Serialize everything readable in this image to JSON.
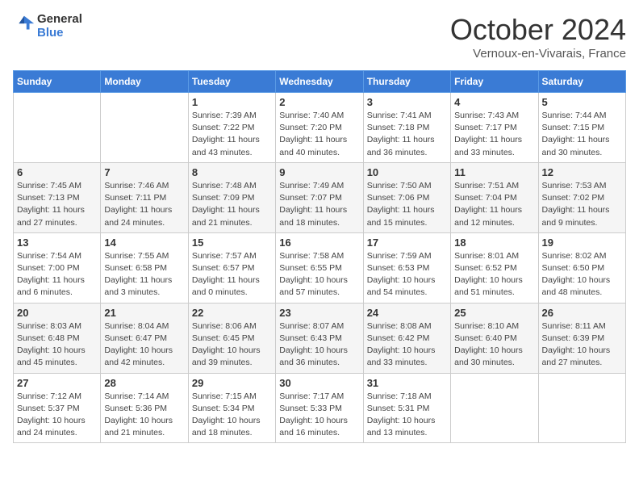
{
  "header": {
    "logo_line1": "General",
    "logo_line2": "Blue",
    "month": "October 2024",
    "location": "Vernoux-en-Vivarais, France"
  },
  "days_of_week": [
    "Sunday",
    "Monday",
    "Tuesday",
    "Wednesday",
    "Thursday",
    "Friday",
    "Saturday"
  ],
  "weeks": [
    [
      {
        "day": "",
        "sunrise": "",
        "sunset": "",
        "daylight": ""
      },
      {
        "day": "",
        "sunrise": "",
        "sunset": "",
        "daylight": ""
      },
      {
        "day": "1",
        "sunrise": "Sunrise: 7:39 AM",
        "sunset": "Sunset: 7:22 PM",
        "daylight": "Daylight: 11 hours and 43 minutes."
      },
      {
        "day": "2",
        "sunrise": "Sunrise: 7:40 AM",
        "sunset": "Sunset: 7:20 PM",
        "daylight": "Daylight: 11 hours and 40 minutes."
      },
      {
        "day": "3",
        "sunrise": "Sunrise: 7:41 AM",
        "sunset": "Sunset: 7:18 PM",
        "daylight": "Daylight: 11 hours and 36 minutes."
      },
      {
        "day": "4",
        "sunrise": "Sunrise: 7:43 AM",
        "sunset": "Sunset: 7:17 PM",
        "daylight": "Daylight: 11 hours and 33 minutes."
      },
      {
        "day": "5",
        "sunrise": "Sunrise: 7:44 AM",
        "sunset": "Sunset: 7:15 PM",
        "daylight": "Daylight: 11 hours and 30 minutes."
      }
    ],
    [
      {
        "day": "6",
        "sunrise": "Sunrise: 7:45 AM",
        "sunset": "Sunset: 7:13 PM",
        "daylight": "Daylight: 11 hours and 27 minutes."
      },
      {
        "day": "7",
        "sunrise": "Sunrise: 7:46 AM",
        "sunset": "Sunset: 7:11 PM",
        "daylight": "Daylight: 11 hours and 24 minutes."
      },
      {
        "day": "8",
        "sunrise": "Sunrise: 7:48 AM",
        "sunset": "Sunset: 7:09 PM",
        "daylight": "Daylight: 11 hours and 21 minutes."
      },
      {
        "day": "9",
        "sunrise": "Sunrise: 7:49 AM",
        "sunset": "Sunset: 7:07 PM",
        "daylight": "Daylight: 11 hours and 18 minutes."
      },
      {
        "day": "10",
        "sunrise": "Sunrise: 7:50 AM",
        "sunset": "Sunset: 7:06 PM",
        "daylight": "Daylight: 11 hours and 15 minutes."
      },
      {
        "day": "11",
        "sunrise": "Sunrise: 7:51 AM",
        "sunset": "Sunset: 7:04 PM",
        "daylight": "Daylight: 11 hours and 12 minutes."
      },
      {
        "day": "12",
        "sunrise": "Sunrise: 7:53 AM",
        "sunset": "Sunset: 7:02 PM",
        "daylight": "Daylight: 11 hours and 9 minutes."
      }
    ],
    [
      {
        "day": "13",
        "sunrise": "Sunrise: 7:54 AM",
        "sunset": "Sunset: 7:00 PM",
        "daylight": "Daylight: 11 hours and 6 minutes."
      },
      {
        "day": "14",
        "sunrise": "Sunrise: 7:55 AM",
        "sunset": "Sunset: 6:58 PM",
        "daylight": "Daylight: 11 hours and 3 minutes."
      },
      {
        "day": "15",
        "sunrise": "Sunrise: 7:57 AM",
        "sunset": "Sunset: 6:57 PM",
        "daylight": "Daylight: 11 hours and 0 minutes."
      },
      {
        "day": "16",
        "sunrise": "Sunrise: 7:58 AM",
        "sunset": "Sunset: 6:55 PM",
        "daylight": "Daylight: 10 hours and 57 minutes."
      },
      {
        "day": "17",
        "sunrise": "Sunrise: 7:59 AM",
        "sunset": "Sunset: 6:53 PM",
        "daylight": "Daylight: 10 hours and 54 minutes."
      },
      {
        "day": "18",
        "sunrise": "Sunrise: 8:01 AM",
        "sunset": "Sunset: 6:52 PM",
        "daylight": "Daylight: 10 hours and 51 minutes."
      },
      {
        "day": "19",
        "sunrise": "Sunrise: 8:02 AM",
        "sunset": "Sunset: 6:50 PM",
        "daylight": "Daylight: 10 hours and 48 minutes."
      }
    ],
    [
      {
        "day": "20",
        "sunrise": "Sunrise: 8:03 AM",
        "sunset": "Sunset: 6:48 PM",
        "daylight": "Daylight: 10 hours and 45 minutes."
      },
      {
        "day": "21",
        "sunrise": "Sunrise: 8:04 AM",
        "sunset": "Sunset: 6:47 PM",
        "daylight": "Daylight: 10 hours and 42 minutes."
      },
      {
        "day": "22",
        "sunrise": "Sunrise: 8:06 AM",
        "sunset": "Sunset: 6:45 PM",
        "daylight": "Daylight: 10 hours and 39 minutes."
      },
      {
        "day": "23",
        "sunrise": "Sunrise: 8:07 AM",
        "sunset": "Sunset: 6:43 PM",
        "daylight": "Daylight: 10 hours and 36 minutes."
      },
      {
        "day": "24",
        "sunrise": "Sunrise: 8:08 AM",
        "sunset": "Sunset: 6:42 PM",
        "daylight": "Daylight: 10 hours and 33 minutes."
      },
      {
        "day": "25",
        "sunrise": "Sunrise: 8:10 AM",
        "sunset": "Sunset: 6:40 PM",
        "daylight": "Daylight: 10 hours and 30 minutes."
      },
      {
        "day": "26",
        "sunrise": "Sunrise: 8:11 AM",
        "sunset": "Sunset: 6:39 PM",
        "daylight": "Daylight: 10 hours and 27 minutes."
      }
    ],
    [
      {
        "day": "27",
        "sunrise": "Sunrise: 7:12 AM",
        "sunset": "Sunset: 5:37 PM",
        "daylight": "Daylight: 10 hours and 24 minutes."
      },
      {
        "day": "28",
        "sunrise": "Sunrise: 7:14 AM",
        "sunset": "Sunset: 5:36 PM",
        "daylight": "Daylight: 10 hours and 21 minutes."
      },
      {
        "day": "29",
        "sunrise": "Sunrise: 7:15 AM",
        "sunset": "Sunset: 5:34 PM",
        "daylight": "Daylight: 10 hours and 18 minutes."
      },
      {
        "day": "30",
        "sunrise": "Sunrise: 7:17 AM",
        "sunset": "Sunset: 5:33 PM",
        "daylight": "Daylight: 10 hours and 16 minutes."
      },
      {
        "day": "31",
        "sunrise": "Sunrise: 7:18 AM",
        "sunset": "Sunset: 5:31 PM",
        "daylight": "Daylight: 10 hours and 13 minutes."
      },
      {
        "day": "",
        "sunrise": "",
        "sunset": "",
        "daylight": ""
      },
      {
        "day": "",
        "sunrise": "",
        "sunset": "",
        "daylight": ""
      }
    ]
  ]
}
